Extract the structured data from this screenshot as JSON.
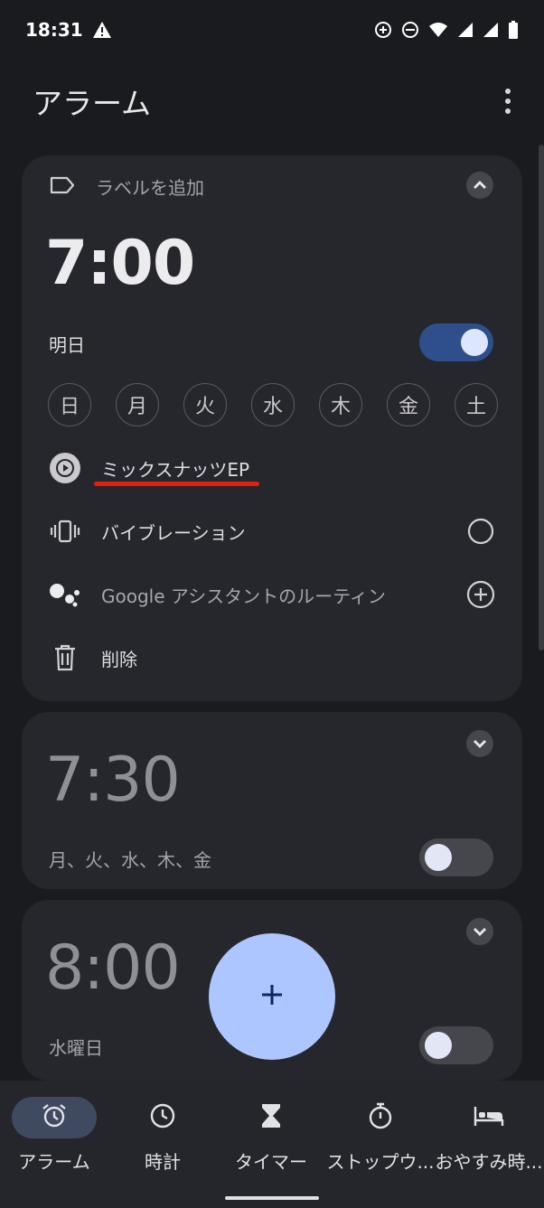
{
  "status_bar": {
    "time": "18:31",
    "icons": [
      "warning-icon",
      "data-saver-icon",
      "do-not-disturb-icon",
      "wifi-icon",
      "signal-icon",
      "battery-icon"
    ]
  },
  "app_bar": {
    "title": "アラーム",
    "menu_icon": "more-vert-icon"
  },
  "alarms": [
    {
      "label_placeholder": "ラベルを追加",
      "time": "7:00",
      "schedule": "明日",
      "enabled": true,
      "days": [
        "日",
        "月",
        "火",
        "水",
        "木",
        "金",
        "土"
      ],
      "ringtone": "ミックスナッツEP",
      "vibration_label": "バイブレーション",
      "assistant_label": "Google アシスタントのルーティン",
      "delete_label": "削除",
      "expanded": true
    },
    {
      "time": "7:30",
      "schedule": "月、火、水、木、金",
      "enabled": false,
      "expanded": false
    },
    {
      "time": "8:00",
      "schedule": "水曜日",
      "enabled": false,
      "expanded": false
    }
  ],
  "fab": {
    "icon": "plus-icon"
  },
  "bottom_nav": [
    {
      "label": "アラーム",
      "icon": "alarm-icon",
      "active": true
    },
    {
      "label": "時計",
      "icon": "clock-icon",
      "active": false
    },
    {
      "label": "タイマー",
      "icon": "hourglass-icon",
      "active": false
    },
    {
      "label": "ストップウ...",
      "icon": "stopwatch-icon",
      "active": false
    },
    {
      "label": "おやすみ時...",
      "icon": "bed-icon",
      "active": false
    }
  ],
  "colors": {
    "background": "#1a1b1f",
    "card": "#26272c",
    "accent": "#adc6ff",
    "toggle_on": "#2f4f8c",
    "underline": "#e3200f"
  }
}
